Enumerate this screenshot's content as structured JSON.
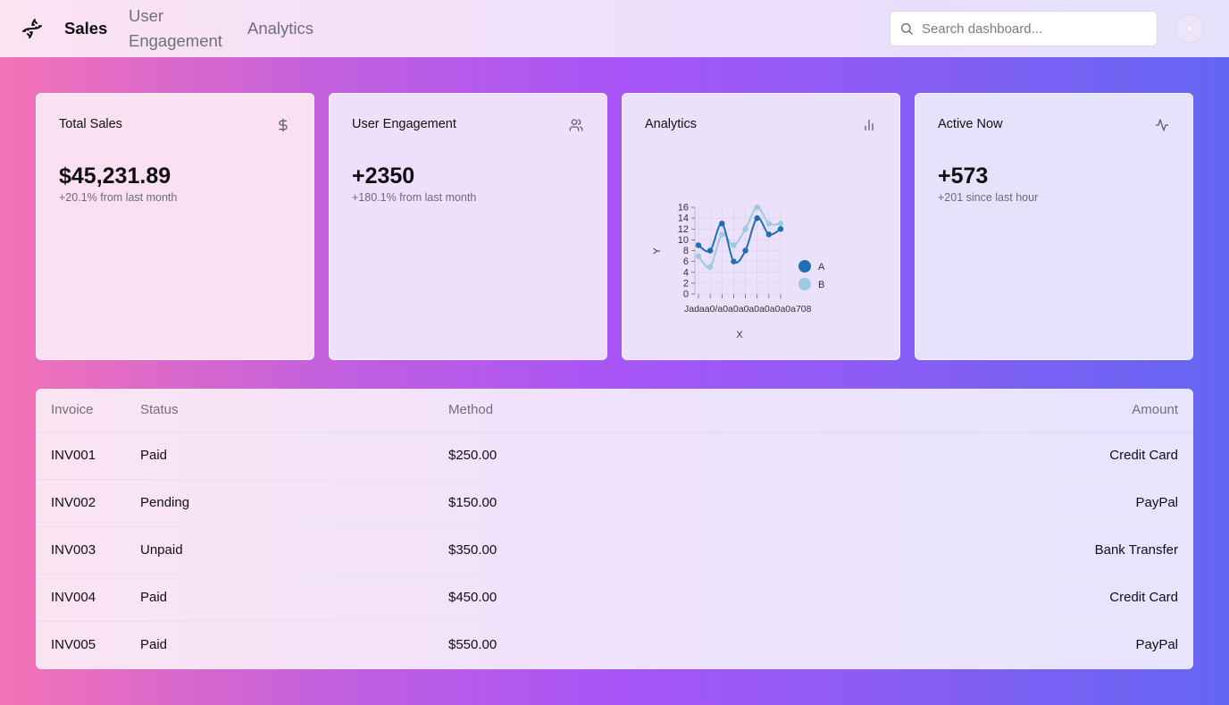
{
  "header": {
    "logo_icon": "dna-icon",
    "nav": [
      {
        "label": "Sales",
        "active": true
      },
      {
        "label": "User Engagement",
        "active": false
      },
      {
        "label": "Analytics",
        "active": false
      }
    ],
    "search": {
      "placeholder": "Search dashboard...",
      "icon": "search-icon"
    },
    "avatar_icon": "avatar"
  },
  "cards": [
    {
      "title": "Total Sales",
      "icon": "dollar-icon",
      "value": "$45,231.89",
      "sub": "+20.1% from last month"
    },
    {
      "title": "User Engagement",
      "icon": "users-icon",
      "value": "+2350",
      "sub": "+180.1% from last month"
    },
    {
      "title": "Analytics",
      "icon": "bar-chart-icon"
    },
    {
      "title": "Active Now",
      "icon": "activity-icon",
      "value": "+573",
      "sub": "+201 since last hour"
    }
  ],
  "chart_data": {
    "type": "line",
    "categories": [
      "Jan",
      "Feb",
      "Mar",
      "Apr",
      "May",
      "Jun",
      "Jul",
      "Aug"
    ],
    "x_tick_text": "Jadaa0/a0a0a0a0a0a0a0a708",
    "series": [
      {
        "name": "A",
        "color": "#1f6fb4",
        "values": [
          9,
          8,
          13,
          6,
          8,
          14,
          11,
          12
        ]
      },
      {
        "name": "B",
        "color": "#9ecae1",
        "values": [
          7,
          5,
          11,
          9,
          12,
          16,
          13,
          13
        ]
      }
    ],
    "xlabel": "X",
    "ylabel": "Y",
    "ylim": [
      0,
      16
    ],
    "yticks": [
      0,
      2,
      4,
      6,
      8,
      10,
      12,
      14,
      16
    ],
    "grid": true,
    "legend": "right"
  },
  "table": {
    "headers": [
      "Invoice",
      "Status",
      "Method",
      "Amount"
    ],
    "rows": [
      [
        "INV001",
        "Paid",
        "$250.00",
        "Credit Card"
      ],
      [
        "INV002",
        "Pending",
        "$150.00",
        "PayPal"
      ],
      [
        "INV003",
        "Unpaid",
        "$350.00",
        "Bank Transfer"
      ],
      [
        "INV004",
        "Paid",
        "$450.00",
        "Credit Card"
      ],
      [
        "INV005",
        "Paid",
        "$550.00",
        "PayPal"
      ]
    ]
  }
}
